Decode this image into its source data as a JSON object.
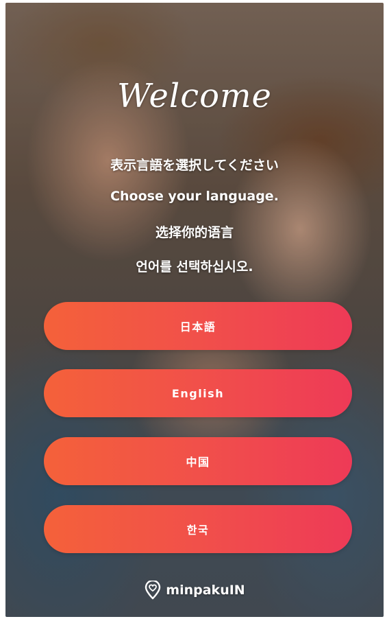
{
  "welcome": {
    "title": "Welcome"
  },
  "prompts": {
    "japanese": "表示言語を選択してください",
    "english": "Choose your language.",
    "chinese": "选择你的语言",
    "korean": "언어를 선택하십시오."
  },
  "languages": [
    {
      "label": "日本語"
    },
    {
      "label": "English"
    },
    {
      "label": "中国"
    },
    {
      "label": "한국"
    }
  ],
  "brand": {
    "name": "minpakuIN",
    "icon": "map-pin-heart-icon"
  },
  "colors": {
    "button_gradient_start": "#f4613a",
    "button_gradient_end": "#ee3a57",
    "text": "#ffffff"
  }
}
